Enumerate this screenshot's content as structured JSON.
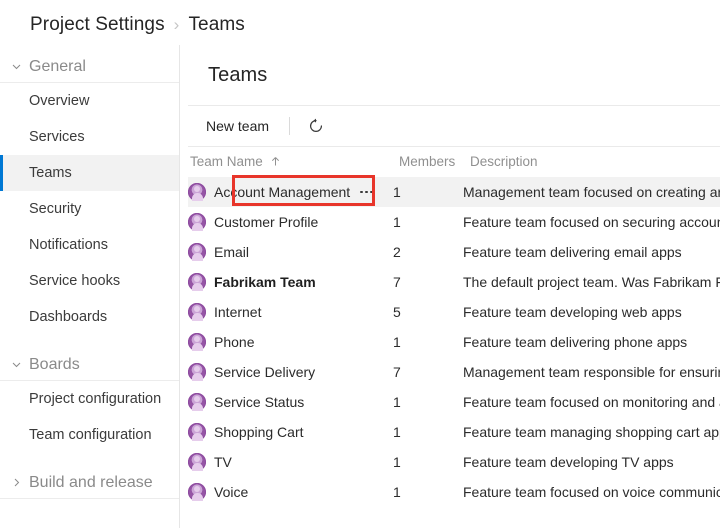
{
  "breadcrumb": {
    "root": "Project Settings",
    "separator": "›",
    "current": "Teams"
  },
  "sidebar": {
    "groups": [
      {
        "label": "General",
        "expanded": true,
        "chevron": "chevron-down-icon",
        "items": [
          {
            "label": "Overview",
            "selected": false
          },
          {
            "label": "Services",
            "selected": false
          },
          {
            "label": "Teams",
            "selected": true
          },
          {
            "label": "Security",
            "selected": false
          },
          {
            "label": "Notifications",
            "selected": false
          },
          {
            "label": "Service hooks",
            "selected": false
          },
          {
            "label": "Dashboards",
            "selected": false
          }
        ]
      },
      {
        "label": "Boards",
        "expanded": true,
        "chevron": "chevron-down-icon",
        "items": [
          {
            "label": "Project configuration",
            "selected": false
          },
          {
            "label": "Team configuration",
            "selected": false
          }
        ]
      },
      {
        "label": "Build and release",
        "expanded": false,
        "chevron": "chevron-right-icon",
        "items": []
      }
    ]
  },
  "main": {
    "title": "Teams",
    "toolbar": {
      "new_team_label": "New team",
      "refresh_icon": "refresh-icon"
    },
    "table": {
      "columns": {
        "name": "Team Name",
        "members": "Members",
        "description": "Description"
      },
      "sort": {
        "column": "Team Name",
        "direction": "asc",
        "icon": "arrow-up-icon"
      },
      "rows": [
        {
          "name": "Account Management",
          "members": "1",
          "description": "Management team focused on creating and managing accounts",
          "bold": false,
          "hover": true,
          "menu": true,
          "avatar": "team-avatar-icon"
        },
        {
          "name": "Customer Profile",
          "members": "1",
          "description": "Feature team focused on securing account information",
          "bold": false,
          "hover": false,
          "menu": false,
          "avatar": "team-avatar-icon"
        },
        {
          "name": "Email",
          "members": "2",
          "description": "Feature team delivering email apps",
          "bold": false,
          "hover": false,
          "menu": false,
          "avatar": "team-avatar-icon"
        },
        {
          "name": "Fabrikam Team",
          "members": "7",
          "description": "The default project team. Was Fabrikam Fiber Team.",
          "bold": true,
          "hover": false,
          "menu": false,
          "avatar": "team-avatar-icon"
        },
        {
          "name": "Internet",
          "members": "5",
          "description": "Feature team developing web apps",
          "bold": false,
          "hover": false,
          "menu": false,
          "avatar": "team-avatar-icon"
        },
        {
          "name": "Phone",
          "members": "1",
          "description": "Feature team delivering phone apps",
          "bold": false,
          "hover": false,
          "menu": false,
          "avatar": "team-avatar-icon"
        },
        {
          "name": "Service Delivery",
          "members": "7",
          "description": "Management team responsible for ensuring service delivery",
          "bold": false,
          "hover": false,
          "menu": false,
          "avatar": "team-avatar-icon"
        },
        {
          "name": "Service Status",
          "members": "1",
          "description": "Feature team focused on monitoring and alerts",
          "bold": false,
          "hover": false,
          "menu": false,
          "avatar": "team-avatar-icon"
        },
        {
          "name": "Shopping Cart",
          "members": "1",
          "description": "Feature team managing shopping cart apps",
          "bold": false,
          "hover": false,
          "menu": false,
          "avatar": "team-avatar-icon"
        },
        {
          "name": "TV",
          "members": "1",
          "description": "Feature team developing TV apps",
          "bold": false,
          "hover": false,
          "menu": false,
          "avatar": "team-avatar-icon"
        },
        {
          "name": "Voice",
          "members": "1",
          "description": "Feature team focused on voice communication apps",
          "bold": false,
          "hover": false,
          "menu": false,
          "avatar": "team-avatar-icon"
        }
      ]
    }
  },
  "annotation": {
    "type": "highlight-rectangle",
    "color": "#e8352a",
    "target": "Account Management"
  },
  "colors": {
    "accent": "#0078d4",
    "avatar": "#9555a5",
    "selected_row_bg": "#f2f2f2",
    "annotation": "#e8352a"
  }
}
